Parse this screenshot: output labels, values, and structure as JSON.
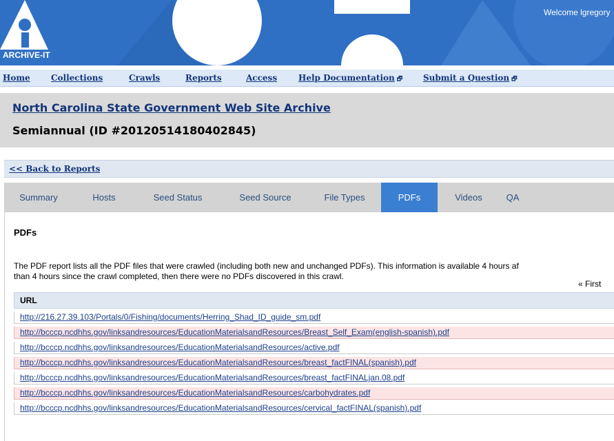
{
  "banner": {
    "logo_text": "ARCHIVE-IT",
    "welcome": "Welcome lgregory"
  },
  "nav": {
    "items": [
      {
        "label": "Home"
      },
      {
        "label": "Collections"
      },
      {
        "label": "Crawls"
      },
      {
        "label": "Reports"
      },
      {
        "label": "Access"
      },
      {
        "label": "Help Documentation",
        "external": true
      },
      {
        "label": "Submit a Question",
        "external": true
      }
    ],
    "external_icon": "external-window-icon",
    "external_glyph": "🗗"
  },
  "page": {
    "collection": "North Carolina State Government Web Site Archive",
    "crawl_title": "Semiannual (ID #20120514180402845)",
    "back_link": "<< Back to Reports"
  },
  "tabs": {
    "items": [
      "Summary",
      "Hosts",
      "Seed Status",
      "Seed Source",
      "File Types",
      "PDFs",
      "Videos",
      "QA"
    ],
    "active": "PDFs"
  },
  "content": {
    "heading": "PDFs",
    "description_line1": "The PDF report lists all the PDF files that were crawled (including both new and unchanged PDFs). This information is available 4 hours af",
    "description_line2": "than 4 hours since the crawl completed, then there were no PDFs discovered in this crawl.",
    "pager_first": "« First",
    "table_header": "URL",
    "urls": [
      "http://216.27.39.103/Portals/0/Fishing/documents/Herring_Shad_ID_guide_sm.pdf",
      "http://bcccp.ncdhhs.gov/linksandresources/EducationMaterialsandResources/Breast_Self_Exam(english-spanish).pdf",
      "http://bcccp.ncdhhs.gov/linksandresources/EducationMaterialsandResources/active.pdf",
      "http://bcccp.ncdhhs.gov/linksandresources/EducationMaterialsandResources/breast_factFINAL(spanish).pdf",
      "http://bcccp.ncdhhs.gov/linksandresources/EducationMaterialsandResources/breast_factFINALjan.08.pdf",
      "http://bcccp.ncdhhs.gov/linksandresources/EducationMaterialsandResources/carbohydrates.pdf",
      "http://bcccp.ncdhhs.gov/linksandresources/EducationMaterialsandResources/cervical_factFINAL(spanish).pdf"
    ]
  },
  "colors": {
    "banner_blue": "#2f6fc4",
    "link_blue": "#13357a",
    "tab_active": "#3a7fd1",
    "row_alt": "#fde4e4"
  }
}
